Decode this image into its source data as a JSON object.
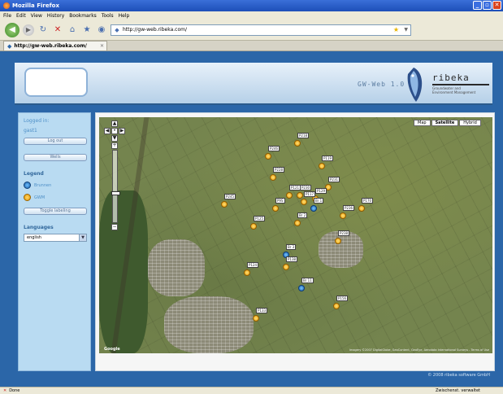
{
  "window": {
    "title": "Mozilla Firefox",
    "controls": [
      "_",
      "▫",
      "✕"
    ]
  },
  "menu": [
    "File",
    "Edit",
    "View",
    "History",
    "Bookmarks",
    "Tools",
    "Help"
  ],
  "navigation": {
    "url": "http://gw-web.ribeka.com/"
  },
  "tab": {
    "title": "http://gw-web.ribeka.com/"
  },
  "banner": {
    "product": "GW-Web 1.0",
    "brand": "ribeka",
    "tagline": "Groundwater and Environment Management"
  },
  "sidebar": {
    "logged_in_label": "Logged in:",
    "username": "gast1",
    "logout_button": "Log out",
    "wells_button": "Wells",
    "legend_heading": "Legend",
    "legend": [
      {
        "label": "Brunnen",
        "icon": "blue-circle-icon",
        "color": "#1a60ad"
      },
      {
        "label": "GWM",
        "icon": "orange-circle-icon",
        "color": "#e89a00"
      }
    ],
    "toggle_button": "Toggle labeling",
    "languages_heading": "Languages",
    "language_selected": "english"
  },
  "map": {
    "type_buttons": [
      {
        "label": "Map",
        "active": false
      },
      {
        "label": "Satellite",
        "active": true
      },
      {
        "label": "Hybrid",
        "active": false
      }
    ],
    "zoom_in": "+",
    "zoom_out": "−",
    "provider": "Google",
    "copyright": "Imagery ©2007 DigitalGlobe, GeoContent, GeoEye, Aerodata International Surveys - Terms of Use",
    "markers": [
      {
        "label": "P218",
        "color": "orange"
      },
      {
        "label": "P246",
        "color": "orange"
      },
      {
        "label": "P228",
        "color": "orange"
      },
      {
        "label": "P119",
        "color": "orange"
      },
      {
        "label": "P231",
        "color": "orange"
      },
      {
        "label": "P129",
        "color": "orange"
      },
      {
        "label": "P245",
        "color": "orange"
      },
      {
        "label": "P121",
        "color": "orange"
      },
      {
        "label": "P117",
        "color": "orange"
      },
      {
        "label": "P230",
        "color": "orange"
      },
      {
        "label": "Br 1",
        "color": "blue"
      },
      {
        "label": "P9S",
        "color": "orange"
      },
      {
        "label": "P125",
        "color": "orange"
      },
      {
        "label": "Br 2",
        "color": "orange"
      },
      {
        "label": "P236",
        "color": "orange"
      },
      {
        "label": "P170",
        "color": "orange"
      },
      {
        "label": "Br 3",
        "color": "blue"
      },
      {
        "label": "P238",
        "color": "orange"
      },
      {
        "label": "P124",
        "color": "orange"
      },
      {
        "label": "P138",
        "color": "orange"
      },
      {
        "label": "Br 11",
        "color": "blue"
      },
      {
        "label": "P156",
        "color": "orange"
      },
      {
        "label": "P133",
        "color": "orange"
      }
    ]
  },
  "footer": "© 2008 ribeka software GmbH",
  "status": {
    "text": "Done",
    "right": "Zwischenst. verwaltet"
  }
}
